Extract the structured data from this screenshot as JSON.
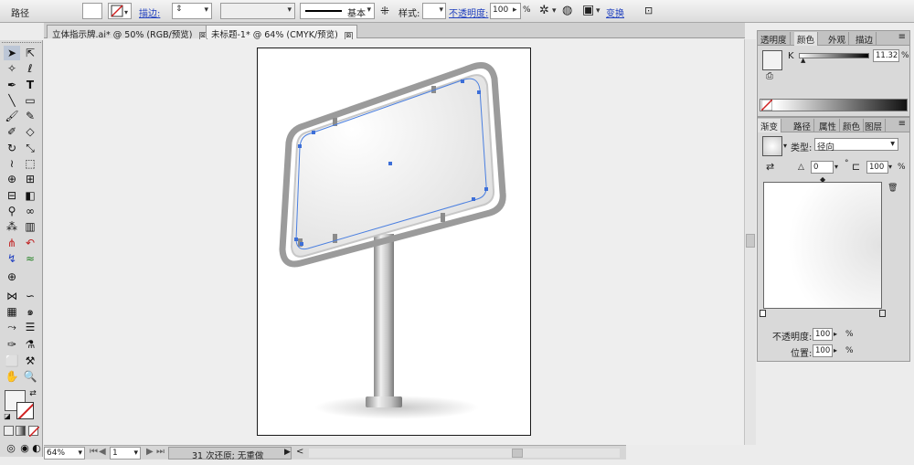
{
  "control_bar": {
    "object_label": "路径",
    "stroke_label": "描边:",
    "profile_label": "基本",
    "style_label": "样式:",
    "opacity_label": "不透明度:",
    "opacity_value": "100",
    "percent": "%",
    "transform_label": "变换"
  },
  "tabs": [
    {
      "label": "立体指示牌.ai* @ 50% (RGB/预览)",
      "close": "⊠"
    },
    {
      "label": "未标题-1* @ 64% (CMYK/预览)",
      "close": "⊠"
    }
  ],
  "status_bar": {
    "zoom": "64%",
    "page": "1",
    "history": "31 次还原; 无重做",
    "play": "▶",
    "left_arrow": "<"
  },
  "panel_color": {
    "tabs": [
      "透明度",
      "颜色",
      "外观",
      "描边"
    ],
    "channel_label": "K",
    "k_value": "11.32",
    "percent": "%"
  },
  "panel_gradient": {
    "tabs": [
      "渐变",
      "路径",
      "属性",
      "颜色",
      "图层"
    ],
    "type_label": "类型:",
    "type_value": "径向",
    "angle_value": "0",
    "degree": "°",
    "aspect_value": "100",
    "percent": "%",
    "opacity_label": "不透明度:",
    "opacity_value": "100",
    "location_label": "位置:",
    "location_value": "100"
  }
}
